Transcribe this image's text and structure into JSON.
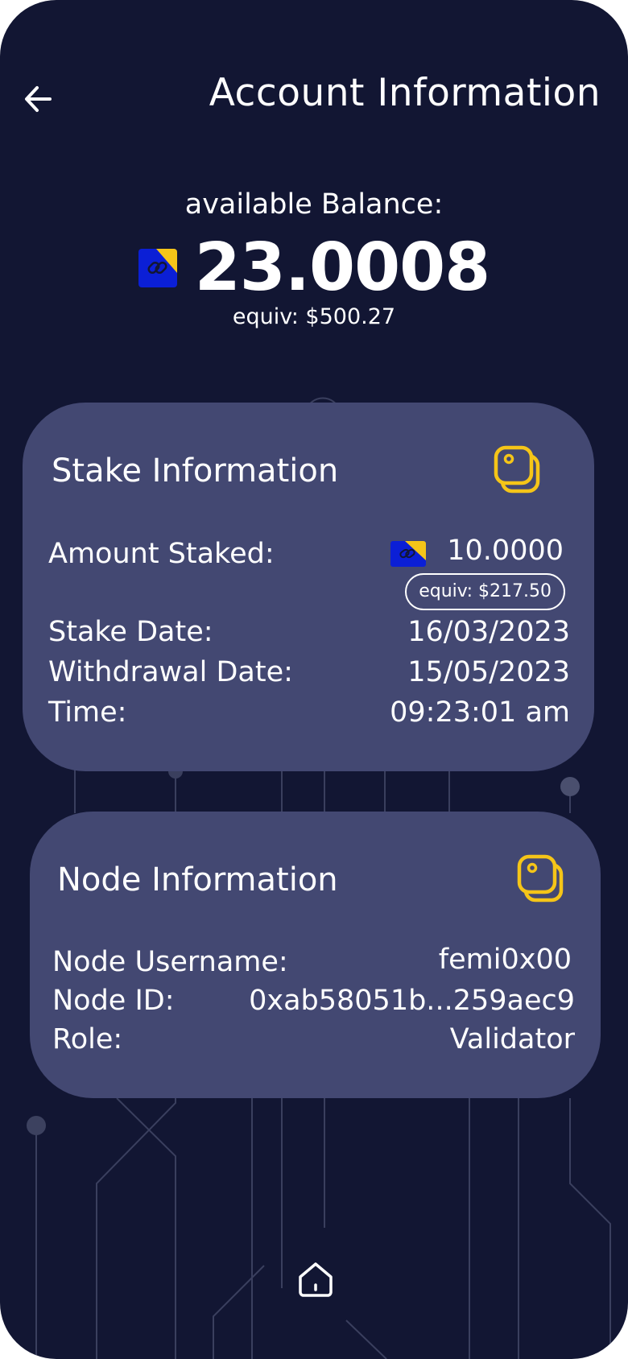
{
  "header": {
    "title": "Account Information",
    "back_icon": "arrow-left-icon"
  },
  "balance": {
    "label": "available Balance:",
    "value": "23.0008",
    "equiv": "equiv: $500.27",
    "coin_icon": "token-coin-icon"
  },
  "stake": {
    "title": "Stake Information",
    "icon": "stacked-tags-icon",
    "rows": [
      {
        "label": "Amount Staked:",
        "value": "10.0000"
      },
      {
        "label": "Stake Date:",
        "value": "16/03/2023"
      },
      {
        "label": "Withdrawal Date:",
        "value": "15/05/2023"
      },
      {
        "label": "Time:",
        "value": "09:23:01 am"
      }
    ],
    "amount_equiv": "equiv: $217.50"
  },
  "node": {
    "title": "Node Information",
    "icon": "stacked-tags-icon",
    "rows": [
      {
        "label": "Node Username:",
        "value": "femi0x00"
      },
      {
        "label": "Node ID:",
        "value": "0xab58051b...259aec9"
      },
      {
        "label": "Role:",
        "value": "Validator"
      }
    ]
  },
  "nav": {
    "home_icon": "home-icon"
  },
  "colors": {
    "background": "#121633",
    "card": "#434872",
    "accent": "#f5c518",
    "coin_blue": "#0b1fd6",
    "coin_yellow": "#f5c518"
  }
}
